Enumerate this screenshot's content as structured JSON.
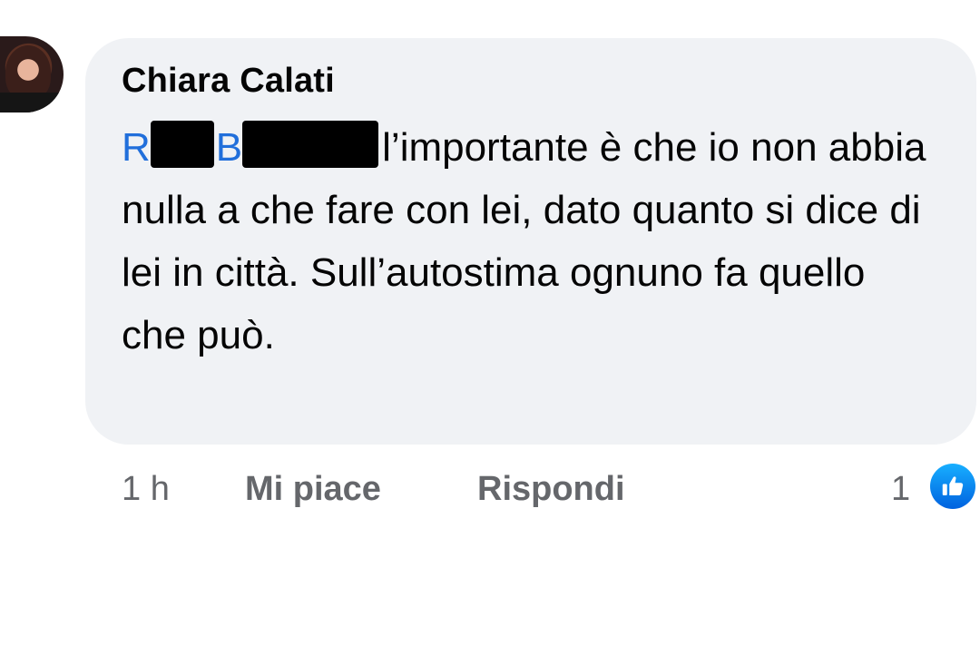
{
  "comment": {
    "author": "Chiara Calati",
    "mention_first_initial": "R",
    "mention_last_initial": "B",
    "text_line1": "l’importante è che io",
    "text_rest": "non abbia nulla a che fare con lei, dato quanto si dice di lei in città. Sull’autostima ognuno fa quello che può."
  },
  "actions": {
    "time": "1 h",
    "like": "Mi piace",
    "reply": "Rispondi"
  },
  "reactions": {
    "count": "1",
    "icon": "thumbs-up-icon",
    "badge_color": "#1877f2"
  },
  "colors": {
    "bubble": "#f0f2f5",
    "mention": "#216fdb",
    "meta": "#65676b"
  }
}
